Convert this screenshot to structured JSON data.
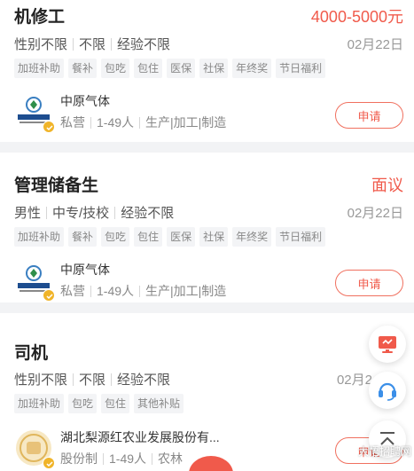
{
  "jobs": [
    {
      "title": "机修工",
      "salary": "4000-5000元",
      "requirements": [
        "性别不限",
        "不限",
        "经验不限"
      ],
      "date": "02月22日",
      "tags": [
        "加班补助",
        "餐补",
        "包吃",
        "包住",
        "医保",
        "社保",
        "年终奖",
        "节日福利"
      ],
      "company": {
        "name": "中原气体",
        "type": "私营",
        "size": "1-49人",
        "industry": "生产|加工|制造"
      },
      "apply_label": "申请"
    },
    {
      "title": "管理储备生",
      "salary": "面议",
      "requirements": [
        "男性",
        "中专/技校",
        "经验不限"
      ],
      "date": "02月22日",
      "tags": [
        "加班补助",
        "餐补",
        "包吃",
        "包住",
        "医保",
        "社保",
        "年终奖",
        "节日福利"
      ],
      "company": {
        "name": "中原气体",
        "type": "私营",
        "size": "1-49人",
        "industry": "生产|加工|制造"
      },
      "apply_label": "申请"
    },
    {
      "title": "司机",
      "salary": "",
      "requirements": [
        "性别不限",
        "不限",
        "经验不限"
      ],
      "date": "02月2",
      "tags": [
        "加班补助",
        "包吃",
        "包住",
        "其他补贴"
      ],
      "company": {
        "name": "湖北梨源红农业发展股份有...",
        "type": "股份制",
        "size": "1-49人",
        "industry": "农林"
      },
      "apply_label": "申请"
    }
  ],
  "watermark": "大悟招聘网",
  "icons": {
    "fab1": "monitor-icon",
    "fab2": "headset-icon",
    "fab3": "back-to-top-icon"
  },
  "colors": {
    "accent": "#f05a4b",
    "tag_bg": "#f3f4f6"
  }
}
